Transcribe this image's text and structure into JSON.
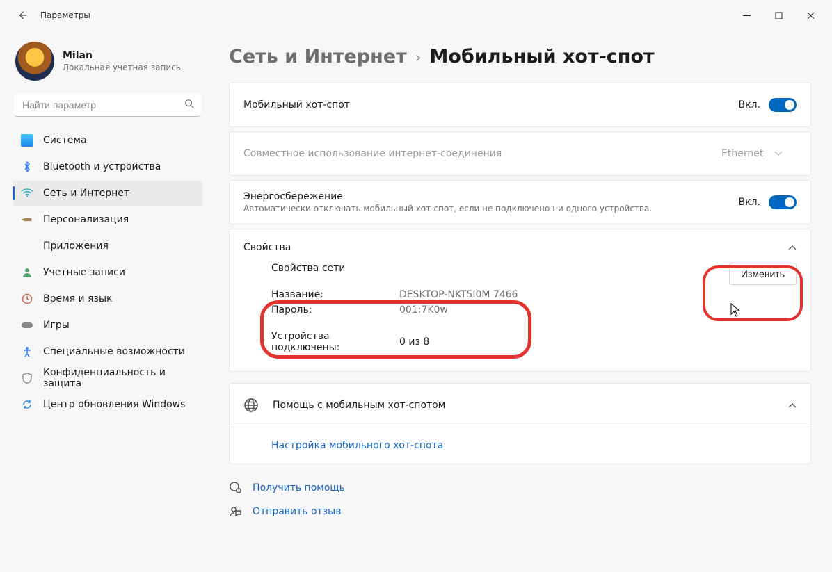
{
  "window": {
    "title": "Параметры"
  },
  "profile": {
    "name": "Milan",
    "sub": "Локальная учетная запись"
  },
  "search": {
    "placeholder": "Найти параметр"
  },
  "sidebar": {
    "items": [
      {
        "label": "Система"
      },
      {
        "label": "Bluetooth и устройства"
      },
      {
        "label": "Сеть и Интернет"
      },
      {
        "label": "Персонализация"
      },
      {
        "label": "Приложения"
      },
      {
        "label": "Учетные записи"
      },
      {
        "label": "Время и язык"
      },
      {
        "label": "Игры"
      },
      {
        "label": "Специальные возможности"
      },
      {
        "label": "Конфиденциальность и защита"
      },
      {
        "label": "Центр обновления Windows"
      }
    ]
  },
  "breadcrumb": {
    "a": "Сеть и Интернет",
    "b": "Мобильный хот-спот"
  },
  "hotspot": {
    "title": "Мобильный хот-спот",
    "state": "Вкл."
  },
  "share": {
    "title": "Совместное использование интернет-соединения",
    "value": "Ethernet"
  },
  "power": {
    "title": "Энергосбережение",
    "sub": "Автоматически отключать мобильный хот-спот, если не подключено ни одного устройства.",
    "state": "Вкл."
  },
  "props": {
    "header": "Свойства",
    "section": "Свойства сети",
    "name_k": "Название:",
    "name_v": "DESKTOP-NKT5I0M 7466",
    "pass_k": "Пароль:",
    "pass_v": "001:7K0w",
    "dev_k": "Устройства подключены:",
    "dev_v": "0 из 8",
    "edit": "Изменить"
  },
  "help": {
    "title": "Помощь с мобильным хот-спотом",
    "link": "Настройка мобильного хот-спота"
  },
  "bottom": {
    "get_help": "Получить помощь",
    "feedback": "Отправить отзыв"
  }
}
